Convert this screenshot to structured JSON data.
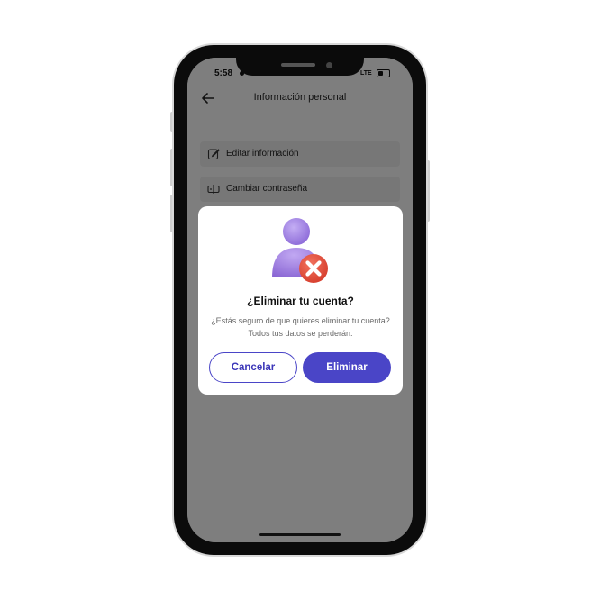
{
  "status_bar": {
    "time": "5:58",
    "network": "LTE"
  },
  "header": {
    "title": "Información personal",
    "back_icon": "arrow-left-icon"
  },
  "menu": {
    "items": [
      {
        "label": "Editar información",
        "icon": "edit-icon"
      },
      {
        "label": "Cambiar contraseña",
        "icon": "password-icon"
      }
    ]
  },
  "dialog": {
    "illustration": "user-delete-icon",
    "title": "¿Eliminar tu cuenta?",
    "message": "¿Estás seguro de que quieres eliminar tu cuenta? Todos tus datos se perderán.",
    "cancel_label": "Cancelar",
    "confirm_label": "Eliminar"
  },
  "colors": {
    "accent": "#4a45c7",
    "avatar": "#a98ae6",
    "danger": "#e24b3b",
    "overlay": "rgba(0,0,0,0.46)"
  }
}
